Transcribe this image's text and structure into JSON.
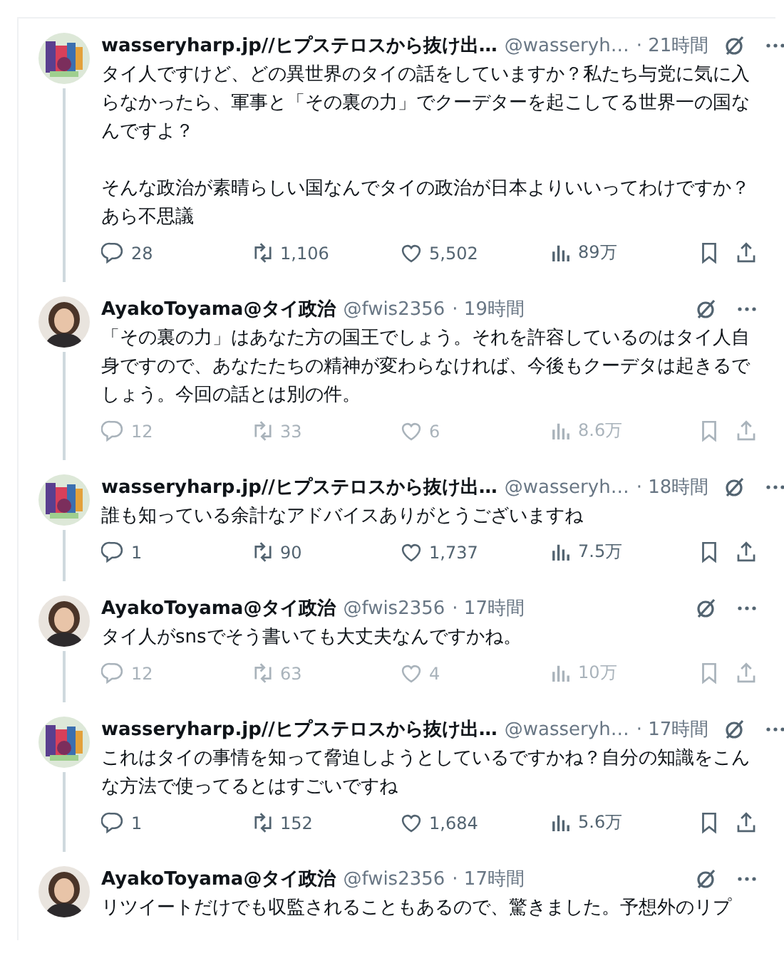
{
  "posts": [
    {
      "name": "wasseryharp.jp//ヒプステロスから抜け出…",
      "handle": "@wasseryh…",
      "time": "· 21時間",
      "paragraphs": [
        [
          "タイ人ですけど、どの異世界のタイの話をしていますか？私たち与党に気に入らなかったら、軍事と「その裏の力」でクーデターを起こしてる世界一の国なんですよ？"
        ],
        [
          "そんな政治が素晴らしい国なんでタイの政治が日本よりいいってわけですか？",
          "あら不思議"
        ]
      ],
      "dimmed": false,
      "replies": "28",
      "reposts": "1,106",
      "likes": "5,502",
      "views": "89万"
    },
    {
      "name": "AyakoToyama@タイ政治",
      "handle": "@fwis2356",
      "time": "· 19時間",
      "paragraphs": [
        [
          "「その裏の力」はあなた方の国王でしょう。それを許容しているのはタイ人自身ですので、あなたたちの精神が変わらなければ、今後もクーデタは起きるでしょう。今回の話とは別の件。"
        ]
      ],
      "dimmed": true,
      "replies": "12",
      "reposts": "33",
      "likes": "6",
      "views": "8.6万"
    },
    {
      "name": "wasseryharp.jp//ヒプステロスから抜け出…",
      "handle": "@wasseryh…",
      "time": "· 18時間",
      "paragraphs": [
        [
          "誰も知っている余計なアドバイスありがとうございますね"
        ]
      ],
      "dimmed": false,
      "replies": "1",
      "reposts": "90",
      "likes": "1,737",
      "views": "7.5万"
    },
    {
      "name": "AyakoToyama@タイ政治",
      "handle": "@fwis2356",
      "time": "· 17時間",
      "paragraphs": [
        [
          "タイ人がsnsでそう書いても大丈夫なんですかね。"
        ]
      ],
      "dimmed": true,
      "replies": "12",
      "reposts": "63",
      "likes": "4",
      "views": "10万"
    },
    {
      "name": "wasseryharp.jp//ヒプステロスから抜け出…",
      "handle": "@wasseryh…",
      "time": "· 17時間",
      "paragraphs": [
        [
          "これはタイの事情を知って脅迫しようとしているですかね？自分の知識をこんな方法で使ってるとはすごいですね"
        ]
      ],
      "dimmed": false,
      "replies": "1",
      "reposts": "152",
      "likes": "1,684",
      "views": "5.6万"
    },
    {
      "name": "AyakoToyama@タイ政治",
      "handle": "@fwis2356",
      "time": "· 17時間",
      "paragraphs": [
        [
          "リツイートだけでも収監されることもあるので、驚きました。予想外のリプ"
        ]
      ]
    }
  ]
}
